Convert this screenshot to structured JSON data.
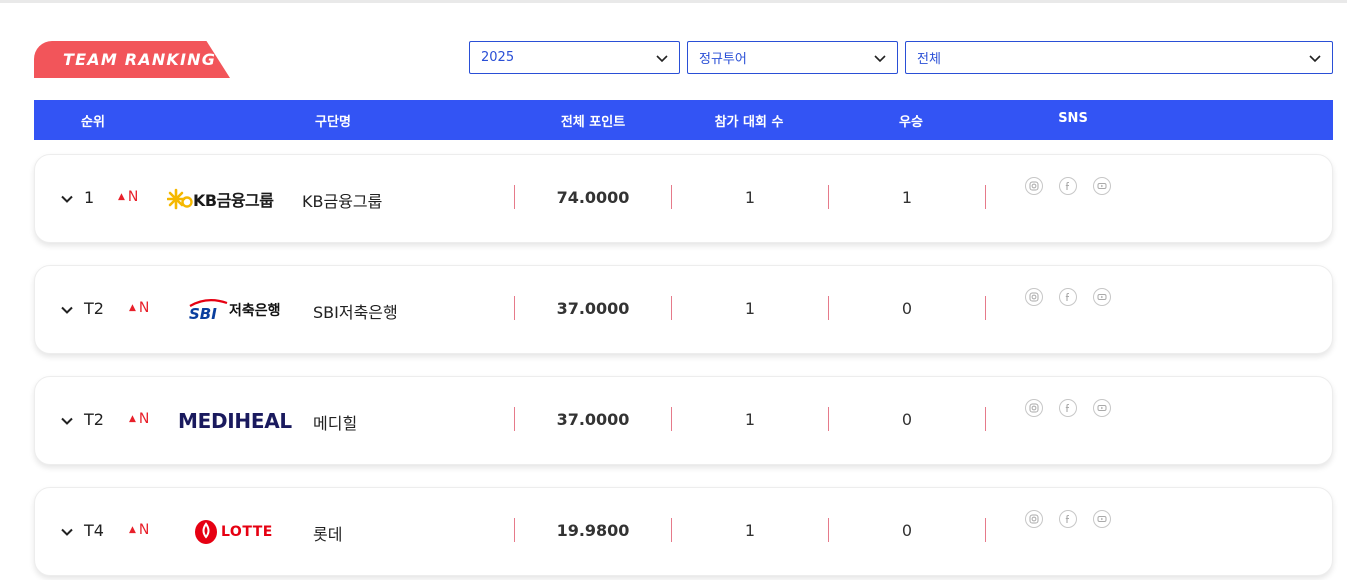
{
  "title": "TEAM RANKING",
  "filters": {
    "year": "2025",
    "tour": "정규투어",
    "category": "전체"
  },
  "columns": {
    "rank": "순위",
    "team": "구단명",
    "points": "전체 포인트",
    "events": "참가 대회 수",
    "wins": "우승",
    "sns": "SNS"
  },
  "rows": [
    {
      "rank": "1",
      "movement": "N",
      "logo_text": "KB금융그룹",
      "team": "KB금융그룹",
      "points": "74.0000",
      "events": "1",
      "wins": "1"
    },
    {
      "rank": "T2",
      "movement": "N",
      "logo_text": "저축은행",
      "logo_mark": "SBI",
      "team": "SBI저축은행",
      "points": "37.0000",
      "events": "1",
      "wins": "0"
    },
    {
      "rank": "T2",
      "movement": "N",
      "logo_text": "MEDIHEAL",
      "team": "메디힐",
      "points": "37.0000",
      "events": "1",
      "wins": "0"
    },
    {
      "rank": "T4",
      "movement": "N",
      "logo_text": "LOTTE",
      "team": "롯데",
      "points": "19.9800",
      "events": "1",
      "wins": "0"
    }
  ],
  "colors": {
    "accent": "#3354f4",
    "badge": "#f2555a",
    "movement": "#e8202a",
    "divider": "#e67a8a"
  },
  "icons": [
    "chevron-down-icon",
    "triangle-up-icon",
    "instagram-icon",
    "facebook-icon",
    "youtube-icon"
  ]
}
